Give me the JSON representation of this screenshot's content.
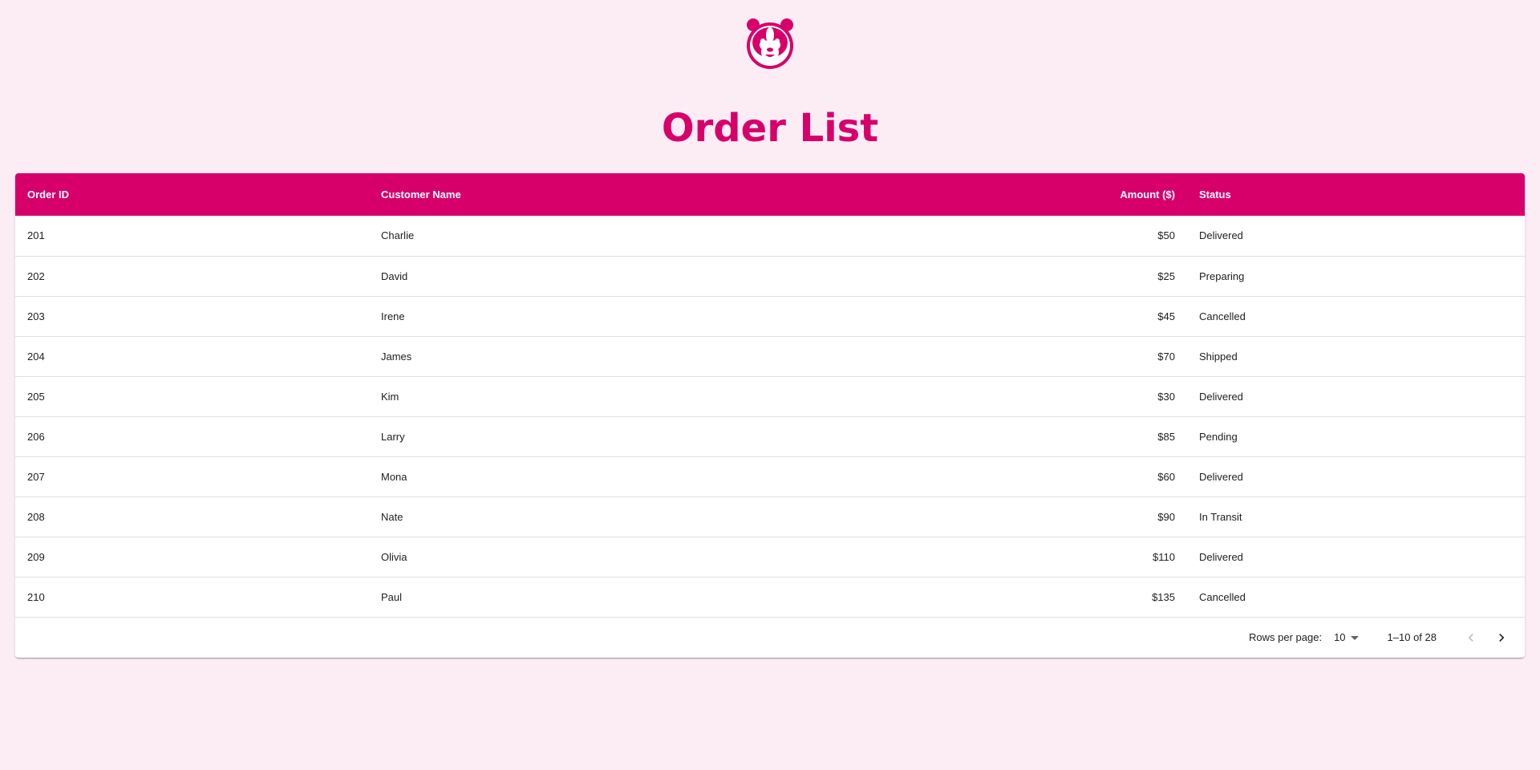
{
  "header": {
    "logo_name": "panda-logo",
    "title": "Order List"
  },
  "table": {
    "columns": {
      "order_id": "Order ID",
      "customer_name": "Customer Name",
      "amount": "Amount ($)",
      "status": "Status"
    },
    "rows": [
      {
        "order_id": "201",
        "customer_name": "Charlie",
        "amount": "$50",
        "status": "Delivered"
      },
      {
        "order_id": "202",
        "customer_name": "David",
        "amount": "$25",
        "status": "Preparing"
      },
      {
        "order_id": "203",
        "customer_name": "Irene",
        "amount": "$45",
        "status": "Cancelled"
      },
      {
        "order_id": "204",
        "customer_name": "James",
        "amount": "$70",
        "status": "Shipped"
      },
      {
        "order_id": "205",
        "customer_name": "Kim",
        "amount": "$30",
        "status": "Delivered"
      },
      {
        "order_id": "206",
        "customer_name": "Larry",
        "amount": "$85",
        "status": "Pending"
      },
      {
        "order_id": "207",
        "customer_name": "Mona",
        "amount": "$60",
        "status": "Delivered"
      },
      {
        "order_id": "208",
        "customer_name": "Nate",
        "amount": "$90",
        "status": "In Transit"
      },
      {
        "order_id": "209",
        "customer_name": "Olivia",
        "amount": "$110",
        "status": "Delivered"
      },
      {
        "order_id": "210",
        "customer_name": "Paul",
        "amount": "$135",
        "status": "Cancelled"
      }
    ]
  },
  "pagination": {
    "rows_per_page_label": "Rows per page:",
    "rows_per_page_value": "10",
    "range_label": "1–10 of 28",
    "prev_icon": "chevron-left-icon",
    "next_icon": "chevron-right-icon"
  },
  "colors": {
    "brand": "#d7006b",
    "background": "#fcedf5"
  }
}
